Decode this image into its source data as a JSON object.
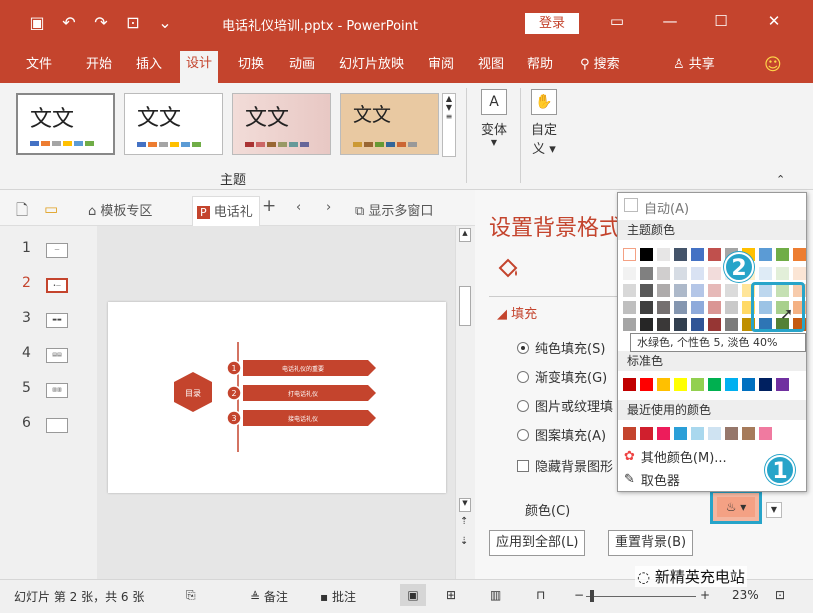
{
  "app": {
    "doc_title": "电话礼仪培训.pptx",
    "app_name": "PowerPoint",
    "login_label": "登录"
  },
  "tabs": [
    "文件",
    "开始",
    "插入",
    "设计",
    "切换",
    "动画",
    "幻灯片放映",
    "审阅",
    "视图",
    "帮助",
    "搜索",
    "共享"
  ],
  "ribbon": {
    "theme_text": "文文",
    "group_label": "主题",
    "variant_label": "变体",
    "custom_label": "自定",
    "custom_label2": "义"
  },
  "file_tabs": {
    "template_zone": "模板专区",
    "doc_tab": "电话礼",
    "multi_window": "显示多窗口"
  },
  "slides": [
    "1",
    "2",
    "3",
    "4",
    "5",
    "6"
  ],
  "slide_content": {
    "hex_label": "目录",
    "items": [
      {
        "num": "1",
        "text": "电话礼仪的重要"
      },
      {
        "num": "2",
        "text": "打电话礼仪"
      },
      {
        "num": "3",
        "text": "接电话礼仪"
      }
    ]
  },
  "pane": {
    "title": "设置背景格式",
    "section": "填充",
    "options": [
      "纯色填充(S)",
      "渐变填充(G)",
      "图片或纹理填",
      "图案填充(A)"
    ],
    "hide_bg": "隐藏背景图形",
    "color_label": "颜色(C)",
    "apply_all": "应用到全部(L)",
    "reset_bg": "重置背景(B)"
  },
  "dropdown": {
    "auto": "自动(A)",
    "theme_colors": "主题颜色",
    "standard_colors": "标准色",
    "recent_colors": "最近使用的颜色",
    "more_colors": "其他颜色(M)...",
    "eyedropper": "取色器",
    "tooltip": "水绿色, 个性色 5, 淡色 40%"
  },
  "badges": [
    "1",
    "2"
  ],
  "status": {
    "slide_info": "幻灯片 第 2 张，共 6 张",
    "notes": "备注",
    "comments": "批注",
    "zoom": "23%",
    "watermark": "新精英充电站"
  },
  "colors": {
    "accent": "#c4442d",
    "highlight": "#27a4c9",
    "fill_preview": "#f4a184"
  }
}
